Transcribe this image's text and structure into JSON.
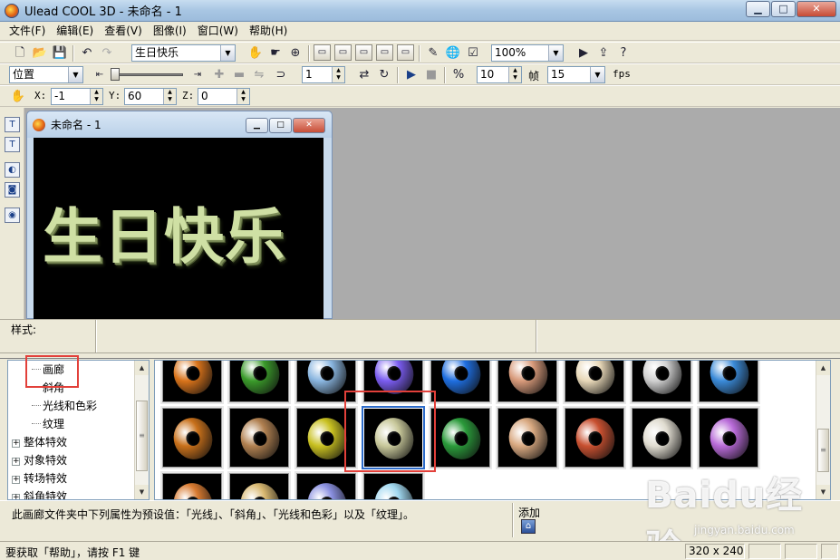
{
  "window": {
    "title": "Ulead COOL 3D - 未命名 - 1",
    "minimize": "▁",
    "maximize": "□",
    "close": "✕"
  },
  "menu": [
    "文件(F)",
    "编辑(E)",
    "查看(V)",
    "图像(I)",
    "窗口(W)",
    "帮助(H)"
  ],
  "toolbar1": {
    "text_combo": "生日快乐",
    "zoom_combo": "100%"
  },
  "toolbar2": {
    "mode_combo": "位置",
    "frame_input": "1",
    "frames_input": "10",
    "frames_label": "帧",
    "fps_combo": "15",
    "fps_label": "fps"
  },
  "toolbar3": {
    "x_label": "X:",
    "x_value": "-1",
    "y_label": "Y:",
    "y_value": "60",
    "z_label": "Z:",
    "z_value": "0"
  },
  "document": {
    "title": "未命名 - 1",
    "text": "生日快乐"
  },
  "style_panel": {
    "label": "样式:"
  },
  "tree": {
    "items": [
      {
        "label": "画廊",
        "type": "leaf"
      },
      {
        "label": "斜角",
        "type": "leaf"
      },
      {
        "label": "光线和色彩",
        "type": "leaf"
      },
      {
        "label": "纹理",
        "type": "leaf"
      },
      {
        "label": "整体特效",
        "type": "group"
      },
      {
        "label": "对象特效",
        "type": "group"
      },
      {
        "label": "转场特效",
        "type": "group"
      },
      {
        "label": "斜角特效",
        "type": "group"
      }
    ]
  },
  "gallery": {
    "rows": [
      [
        {
          "c": "#d9731a"
        },
        {
          "c": "#3a9a2a"
        },
        {
          "c": "#8ab6e0"
        },
        {
          "c": "#7a5cf0"
        },
        {
          "c": "#1e6ee0"
        },
        {
          "c": "#d89a7a"
        },
        {
          "c": "#e8d8b8"
        },
        {
          "c": "#d0d0d0"
        },
        {
          "c": "#3a8ad8"
        }
      ],
      [
        {
          "c": "#c8701a"
        },
        {
          "c": "#b08050"
        },
        {
          "c": "#c8c020"
        },
        {
          "c": "#c8c89a",
          "selected": true
        },
        {
          "c": "#2a9a3a"
        },
        {
          "c": "#d8a880"
        },
        {
          "c": "#c85030"
        },
        {
          "c": "#e0dcd0"
        },
        {
          "c": "#b86ad8"
        }
      ],
      [
        {
          "c": "#d87a30"
        },
        {
          "c": "#d8b870"
        },
        {
          "c": "#8a90e0"
        },
        {
          "c": "#a0d8f0"
        }
      ]
    ]
  },
  "description": "此画廊文件夹中下列属性为预设值：「光线」、「斜角」、「光线和色彩」以及「纹理」。",
  "add_button": {
    "label": "添加"
  },
  "status": {
    "help_text": "要获取「帮助」，请按 F1 键",
    "size": "320 x 240"
  },
  "watermark": {
    "brand": "Baidu经验",
    "url": "jingyan.baidu.com"
  }
}
